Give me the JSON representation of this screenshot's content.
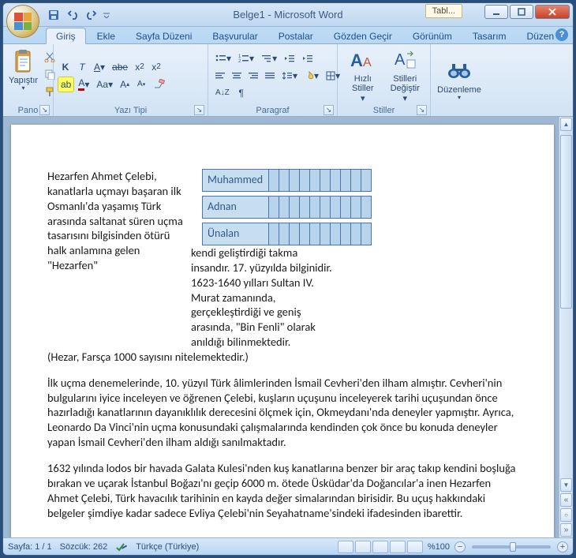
{
  "window": {
    "title": "Belge1 - Microsoft Word",
    "context_tab": "Tabl..."
  },
  "qat": {
    "save": "save",
    "undo": "undo",
    "redo": "redo"
  },
  "tabs": {
    "home": "Giriş",
    "insert": "Ekle",
    "pagelayout": "Sayfa Düzeni",
    "references": "Başvurular",
    "mailings": "Postalar",
    "review": "Gözden Geçir",
    "view": "Görünüm",
    "design": "Tasarım",
    "layout": "Düzen"
  },
  "ribbon": {
    "clipboard": {
      "label": "Pano",
      "paste": "Yapıştır"
    },
    "font": {
      "label": "Yazı Tipi"
    },
    "paragraph": {
      "label": "Paragraf"
    },
    "styles": {
      "label": "Stiller",
      "quick": "Hızlı Stiller",
      "change": "Stilleri Değiştir"
    },
    "editing": {
      "label": "",
      "find": "Düzenleme"
    }
  },
  "document": {
    "para1_left": "Hezarfen Ahmet Çelebi, kanatlarla uçmayı başaran ilk Osmanlı'da yaşamış Türk arasında saltanat süren uçma tasarısını bilgisinden ötürü halk anlamına gelen \"Hezarfen\"",
    "para1_right": "kendi geliştirdiği takma insandır. 17. yüzyılda bilginidir. 1623-1640 yılları Sultan IV. Murat zamanında, gerçekleştirdiği ve geniş arasında, \"Bin Fenli\" olarak anıldığı bilinmektedir.",
    "para1_after": "(Hezar, Farsça 1000 sayısını nitelemektedir.)",
    "table": {
      "r1": "Muhammed",
      "r2": "Adnan",
      "r3": "Ünalan"
    },
    "para2": "İlk uçma denemelerinde, 10. yüzyıl Türk âlimlerinden İsmail Cevheri'den ilham almıştır. Cevheri'nin bulgularını iyice inceleyen ve öğrenen Çelebi, kuşların uçuşunu inceleyerek tarihi uçuşundan önce hazırladığı kanatlarının dayanıklılık derecesini ölçmek için, Okmeydanı'nda deneyler yapmıştır. Ayrıca, Leonardo Da Vinci'nin uçma konusundaki çalışmalarında kendinden çok önce bu konuda deneyler yapan İsmail Cevheri'den ilham aldığı sanılmaktadır.",
    "para3": "1632 yılında lodos bir havada Galata Kulesi'nden kuş kanatlarına benzer bir araç takıp kendini boşluğa bırakan ve uçarak İstanbul Boğazı'nı geçip 6000 m. ötede Üsküdar'da Doğancılar'a inen Hezarfen Ahmet Çelebi, Türk havacılık tarihinin en kayda değer simalarından birisidir. Bu uçuş hakkındaki belgeler şimdiye kadar sadece Evliya Çelebi'nin Seyahatname'sindeki ifadesinden ibarettir."
  },
  "status": {
    "page": "Sayfa: 1 / 1",
    "words": "Sözcük: 262",
    "lang": "Türkçe (Türkiye)",
    "zoom": "%100"
  }
}
